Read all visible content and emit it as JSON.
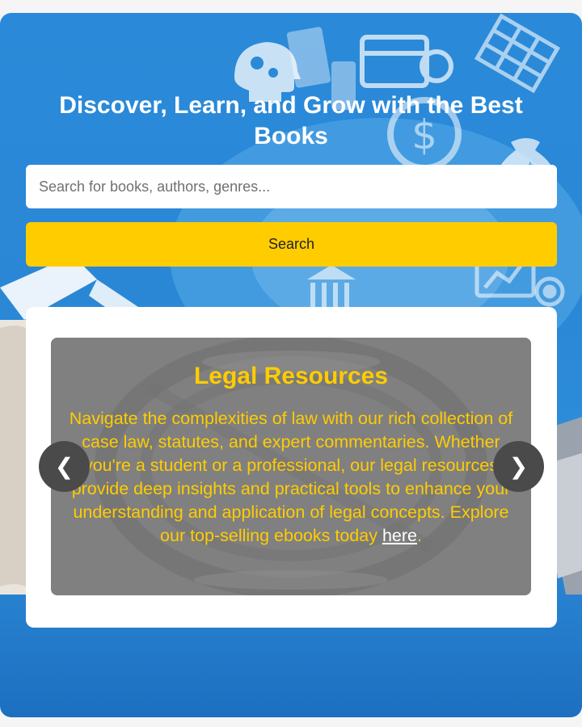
{
  "hero": {
    "title": "Discover, Learn, and Grow with the Best Books"
  },
  "search": {
    "placeholder": "Search for books, authors, genres...",
    "value": "",
    "button_label": "Search"
  },
  "carousel": {
    "prev_label": "❮",
    "next_label": "❯",
    "slide": {
      "title": "Legal Resources",
      "text_before_link": "Navigate the complexities of law with our rich collection of case law, statutes, and expert commentaries. Whether you're a student or a professional, our legal resources provide deep insights and practical tools to enhance your understanding and application of legal concepts. Explore our top-selling ebooks today ",
      "link_label": "here",
      "text_after_link": "."
    }
  },
  "colors": {
    "hero_blue": "#2a8ad9",
    "accent_yellow": "#ffcc00",
    "slide_gray": "#808080",
    "arrow_dark": "#4a4a4a"
  },
  "icons": {
    "prev": "chevron-left-icon",
    "next": "chevron-right-icon"
  }
}
